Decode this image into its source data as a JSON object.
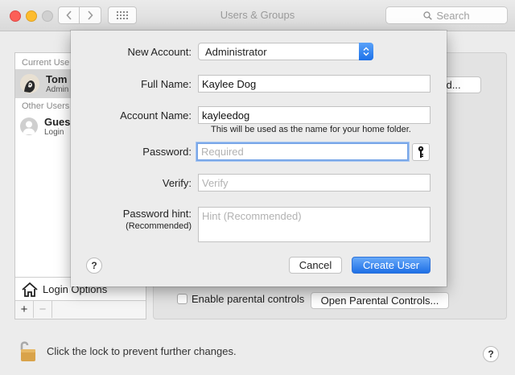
{
  "window": {
    "title": "Users & Groups"
  },
  "toolbar": {
    "search_placeholder": "Search"
  },
  "sidebar": {
    "current_users_header": "Current Use",
    "current_user": {
      "name": "Tom N",
      "role": "Admin"
    },
    "other_users_header": "Other Users",
    "guest_user": {
      "name": "Gues",
      "role": "Login"
    },
    "login_options_label": "Login Options",
    "add_label": "+",
    "remove_label": "−"
  },
  "panel": {
    "change_password_label": "ord...",
    "parental_controls_label": "Enable parental controls",
    "open_parental_controls_label": "Open Parental Controls...",
    "lock_text": "Click the lock to prevent further changes.",
    "help_label": "?"
  },
  "sheet": {
    "new_account_label": "New Account:",
    "new_account_value": "Administrator",
    "full_name_label": "Full Name:",
    "full_name_value": "Kaylee Dog",
    "account_name_label": "Account Name:",
    "account_name_value": "kayleedog",
    "account_name_note": "This will be used as the name for your home folder.",
    "password_label": "Password:",
    "password_placeholder": "Required",
    "verify_label": "Verify:",
    "verify_placeholder": "Verify",
    "hint_label_line1": "Password hint:",
    "hint_label_line2": "(Recommended)",
    "hint_placeholder": "Hint (Recommended)",
    "help_label": "?",
    "cancel_label": "Cancel",
    "create_label": "Create User"
  },
  "colors": {
    "accent": "#1e6fe6",
    "focus_ring": "#7aa7e8"
  }
}
